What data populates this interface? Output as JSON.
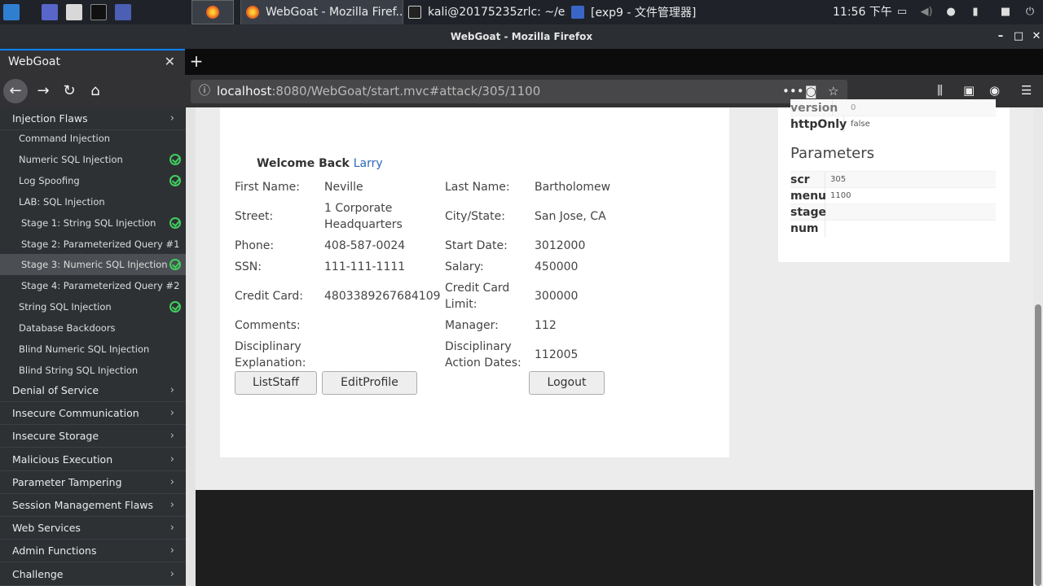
{
  "os_panel": {
    "tasks": [
      {
        "label": "WebGoat - Mozilla Firef...",
        "icon": "firefox-icon"
      },
      {
        "label": "kali@20175235zrlc: ~/e...",
        "icon": "terminal-icon"
      },
      {
        "label": "[exp9 - 文件管理器]",
        "icon": "folder-icon"
      }
    ],
    "clock": "11:56 下午"
  },
  "window": {
    "title": "WebGoat - Mozilla Firefox",
    "minimize": "–",
    "maximize": "□",
    "close": "✕"
  },
  "browser": {
    "tab_title": "WebGoat",
    "tab_close": "✕",
    "new_tab": "+",
    "url_host": "localhost",
    "url_rest": ":8080/WebGoat/start.mvc#attack/305/1100"
  },
  "sidebar": {
    "categories_top": [
      {
        "label": "Injection Flaws",
        "chev": "›"
      }
    ],
    "items": [
      {
        "label": "Command Injection",
        "done": false,
        "indent": 23
      },
      {
        "label": "Numeric SQL Injection",
        "done": true,
        "indent": 23
      },
      {
        "label": "Log Spoofing",
        "done": true,
        "indent": 23
      },
      {
        "label": "LAB: SQL Injection",
        "done": false,
        "indent": 23
      },
      {
        "label": "Stage 1: String SQL Injection",
        "done": true,
        "indent": 26
      },
      {
        "label": "Stage 2: Parameterized Query #1",
        "done": false,
        "indent": 26
      },
      {
        "label": "Stage 3: Numeric SQL Injection",
        "done": true,
        "indent": 26,
        "active": true
      },
      {
        "label": "Stage 4: Parameterized Query #2",
        "done": false,
        "indent": 26
      },
      {
        "label": "String SQL Injection",
        "done": true,
        "indent": 23
      },
      {
        "label": "Database Backdoors",
        "done": false,
        "indent": 23
      },
      {
        "label": "Blind Numeric SQL Injection",
        "done": false,
        "indent": 23
      },
      {
        "label": "Blind String SQL Injection",
        "done": false,
        "indent": 23
      }
    ],
    "categories": [
      {
        "label": "Denial of Service"
      },
      {
        "label": "Insecure Communication"
      },
      {
        "label": "Insecure Storage"
      },
      {
        "label": "Malicious Execution"
      },
      {
        "label": "Parameter Tampering"
      },
      {
        "label": "Session Management Flaws"
      },
      {
        "label": "Web Services"
      },
      {
        "label": "Admin Functions"
      },
      {
        "label": "Challenge"
      }
    ],
    "chev": "›"
  },
  "profile": {
    "welcome_prefix": "Welcome Back",
    "welcome_name": "Larry",
    "fields": {
      "first_name_label": "First Name:",
      "first_name": "Neville",
      "last_name_label": "Last Name:",
      "last_name": "Bartholomew",
      "street_label": "Street:",
      "street_1": "1 Corporate",
      "street_2": "Headquarters",
      "city_label": "City/State:",
      "city": "San Jose, CA",
      "phone_label": "Phone:",
      "phone": "408-587-0024",
      "start_label": "Start Date:",
      "start": "3012000",
      "ssn_label": "SSN:",
      "ssn": "111-111-1111",
      "salary_label": "Salary:",
      "salary": "450000",
      "cc_label": "Credit Card:",
      "cc": "4803389267684109",
      "ccl_label_1": "Credit Card",
      "ccl_label_2": "Limit:",
      "ccl": "300000",
      "comments_label": "Comments:",
      "manager_label": "Manager:",
      "manager": "112",
      "disc_label_1": "Disciplinary",
      "disc_label_2": "Explanation:",
      "dad_label_1": "Disciplinary",
      "dad_label_2": "Action Dates:",
      "dad": "112005"
    },
    "buttons": {
      "list_staff": "ListStaff",
      "edit_profile": "EditProfile",
      "logout": "Logout"
    }
  },
  "info_panel": {
    "cookie_rows": [
      {
        "key": "version",
        "value": "0"
      },
      {
        "key": "httpOnly",
        "value": "false"
      }
    ],
    "params_title": "Parameters",
    "params": [
      {
        "key": "scr",
        "value": "305"
      },
      {
        "key": "menu",
        "value": "1100"
      },
      {
        "key": "stage",
        "value": ""
      },
      {
        "key": "num",
        "value": ""
      }
    ]
  }
}
